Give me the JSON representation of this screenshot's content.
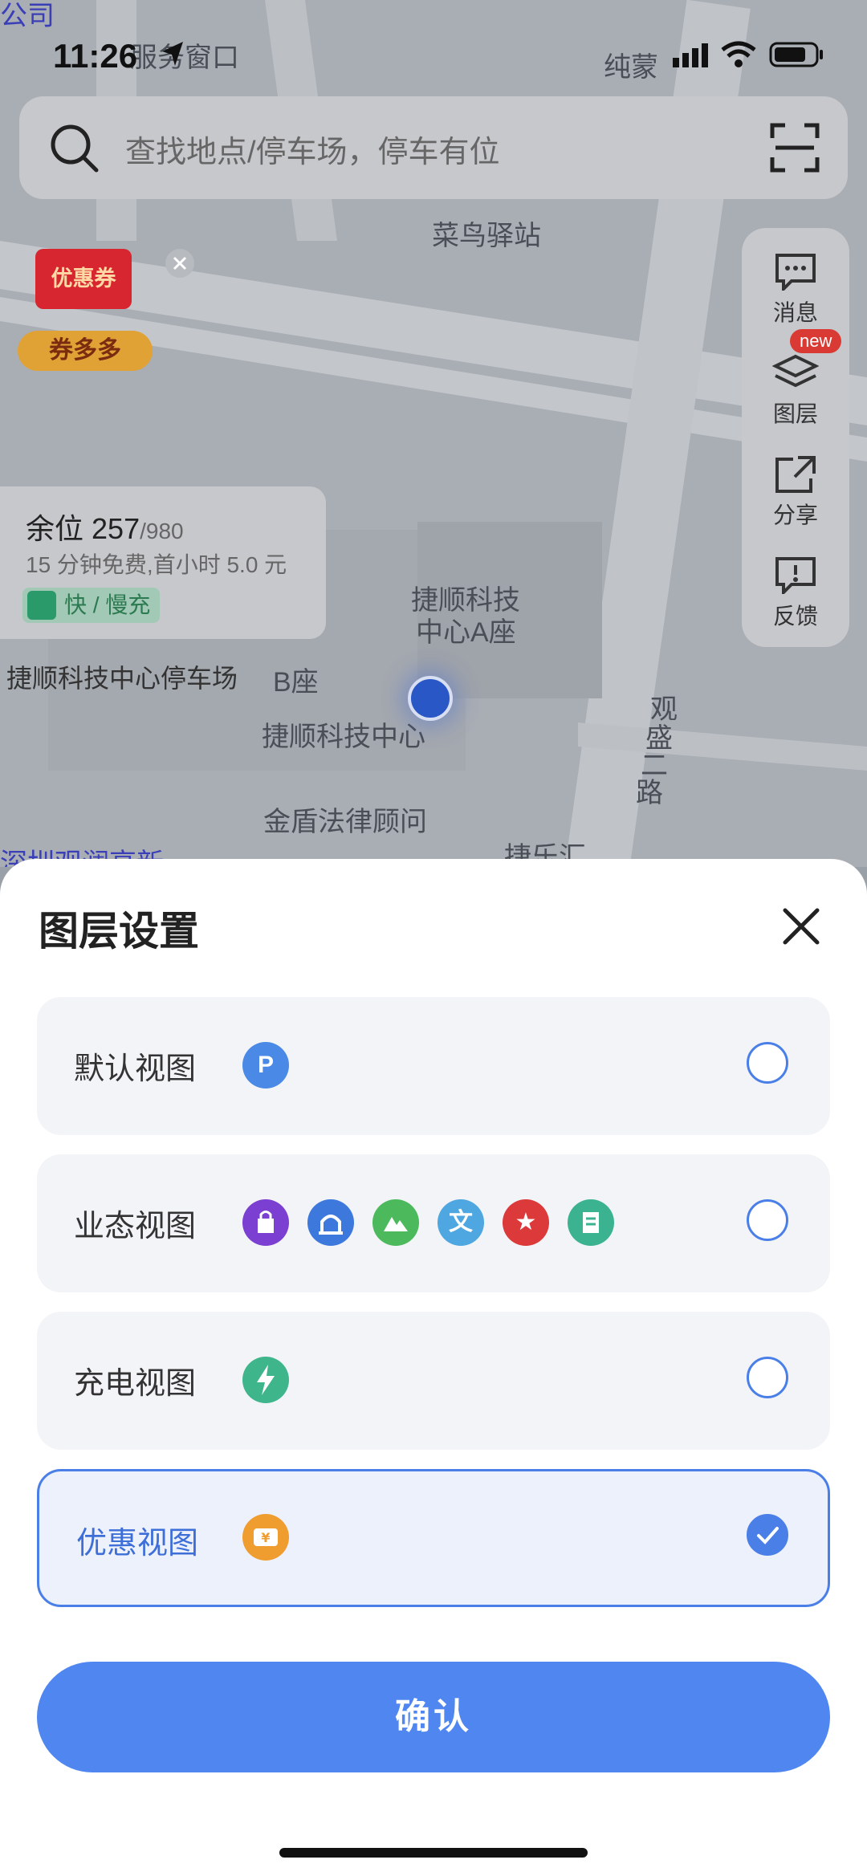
{
  "status_bar": {
    "time": "11:26"
  },
  "search": {
    "placeholder": "查找地点/停车场，停车有位",
    "icon": "search-icon",
    "scan_icon": "scan-icon"
  },
  "promo": {
    "tag": "优惠券",
    "button": "券多多"
  },
  "map_labels": {
    "l1": "菜鸟驿站",
    "l2": "纯蒙",
    "l3": "服务窗口",
    "l4": "捷顺科技",
    "l5": "中心A座",
    "l6": "捷顺科技中心",
    "l7": "金盾法律顾问",
    "l8": "观",
    "l9": "盛",
    "l10": "二",
    "l11": "路",
    "l12": "捷乐汇",
    "l13": "深圳观澜高新",
    "l14": "B座",
    "l15": "公司"
  },
  "side_tools": [
    {
      "label": "消息",
      "icon": "message-icon"
    },
    {
      "label": "图层",
      "icon": "layers-icon",
      "badge": "new"
    },
    {
      "label": "分享",
      "icon": "share-icon"
    },
    {
      "label": "反馈",
      "icon": "feedback-icon"
    }
  ],
  "parking_card": {
    "avail_label": "余位",
    "avail": "257",
    "total": "/980",
    "desc": "15 分钟免费,首小时 5.0 元",
    "chip": "快 / 慢充"
  },
  "lot_label": "捷顺科技中心停车场",
  "sheet": {
    "title": "图层设置",
    "options": [
      {
        "label": "默认视图",
        "icons": [
          "parking-icon"
        ],
        "selected": false
      },
      {
        "label": "业态视图",
        "icons": [
          "shopping-bag-icon",
          "transit-icon",
          "mountain-icon",
          "culture-icon",
          "star-icon",
          "document-icon"
        ],
        "selected": false
      },
      {
        "label": "充电视图",
        "icons": [
          "charging-bolt-icon"
        ],
        "selected": false
      },
      {
        "label": "优惠视图",
        "icons": [
          "coupon-icon"
        ],
        "selected": true
      }
    ],
    "confirm": "确认"
  },
  "colors": {
    "accent": "#4f86ef",
    "selected_border": "#4a7fe8"
  }
}
